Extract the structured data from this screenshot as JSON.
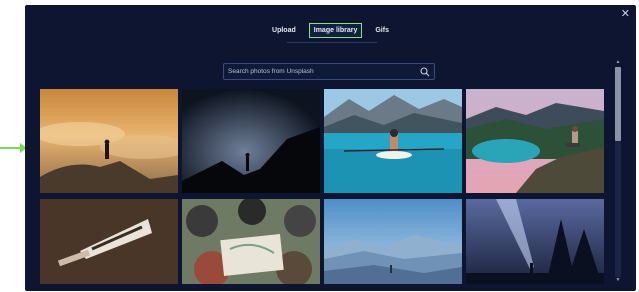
{
  "tabs": [
    {
      "label": "Upload",
      "active": false
    },
    {
      "label": "Image library",
      "active": true
    },
    {
      "label": "Gifs",
      "active": false
    }
  ],
  "search": {
    "placeholder": "Search photos from Unsplash",
    "value": ""
  },
  "photos": [
    {
      "subject": "person-on-cliff-above-clouds"
    },
    {
      "subject": "silhouette-night-sky"
    },
    {
      "subject": "kayak-on-turquoise-lake"
    },
    {
      "subject": "person-sitting-above-lake"
    },
    {
      "subject": "explore-pennant-flag"
    },
    {
      "subject": "group-with-map"
    },
    {
      "subject": "hazy-mountain-layers"
    },
    {
      "subject": "flashlight-beam-forest"
    }
  ],
  "colors": {
    "modal_bg": "#0d1530",
    "active_tab_outline": "#8ee07a",
    "arrow": "#7ed957"
  },
  "icons": {
    "close": "close-icon",
    "search": "search-icon",
    "arrow": "arrow-right-icon"
  }
}
